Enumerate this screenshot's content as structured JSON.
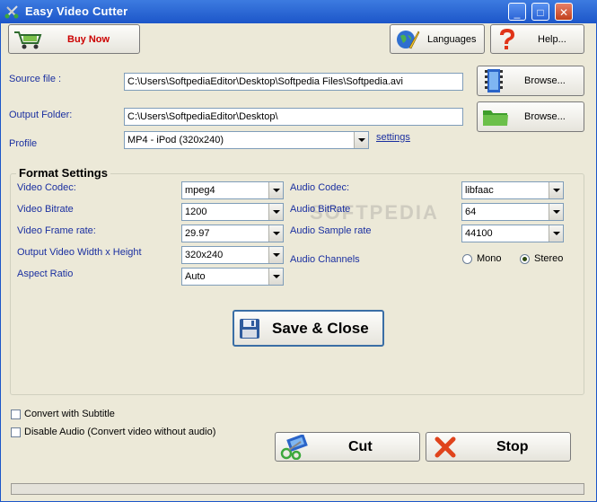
{
  "window": {
    "title": "Easy Video Cutter",
    "minimize": "_",
    "maximize": "□",
    "close": "✕"
  },
  "toolbar": {
    "buy_now": "Buy Now",
    "languages": "Languages",
    "help": "Help..."
  },
  "source": {
    "label": "Source file :",
    "value": "C:\\Users\\SoftpediaEditor\\Desktop\\Softpedia Files\\Softpedia.avi",
    "browse": "Browse..."
  },
  "output": {
    "label": "Output Folder:",
    "value": "C:\\Users\\SoftpediaEditor\\Desktop\\",
    "browse": "Browse..."
  },
  "profile": {
    "label": "Profile",
    "value": "MP4 - iPod (320x240)",
    "settings_link": "settings"
  },
  "format": {
    "title": "Format Settings",
    "video_codec": {
      "label": "Video Codec:",
      "value": "mpeg4"
    },
    "video_bitrate": {
      "label": "Video Bitrate",
      "value": "1200"
    },
    "video_frame_rate": {
      "label": "Video Frame rate:",
      "value": "29.97"
    },
    "output_size": {
      "label": "Output Video Width x Height",
      "value": "320x240"
    },
    "aspect_ratio": {
      "label": "Aspect Ratio",
      "value": "Auto"
    },
    "audio_codec": {
      "label": "Audio Codec:",
      "value": "libfaac"
    },
    "audio_bitrate": {
      "label": "Audio BitRate",
      "value": "64"
    },
    "audio_sample_rate": {
      "label": "Audio Sample rate",
      "value": "44100"
    },
    "audio_channels": {
      "label": "Audio Channels",
      "mono": "Mono",
      "stereo": "Stereo",
      "selected": "Stereo"
    },
    "save_close": "Save & Close"
  },
  "options": {
    "subtitle": "Convert with Subtitle",
    "disable_audio": "Disable Audio (Convert video without audio)"
  },
  "actions": {
    "cut": "Cut",
    "stop": "Stop"
  },
  "watermark": "SOFTPEDIA",
  "colors": {
    "label_blue": "#1a2fa0",
    "title_bar": "#1c56c9",
    "buy_now_red": "#cc0000"
  }
}
